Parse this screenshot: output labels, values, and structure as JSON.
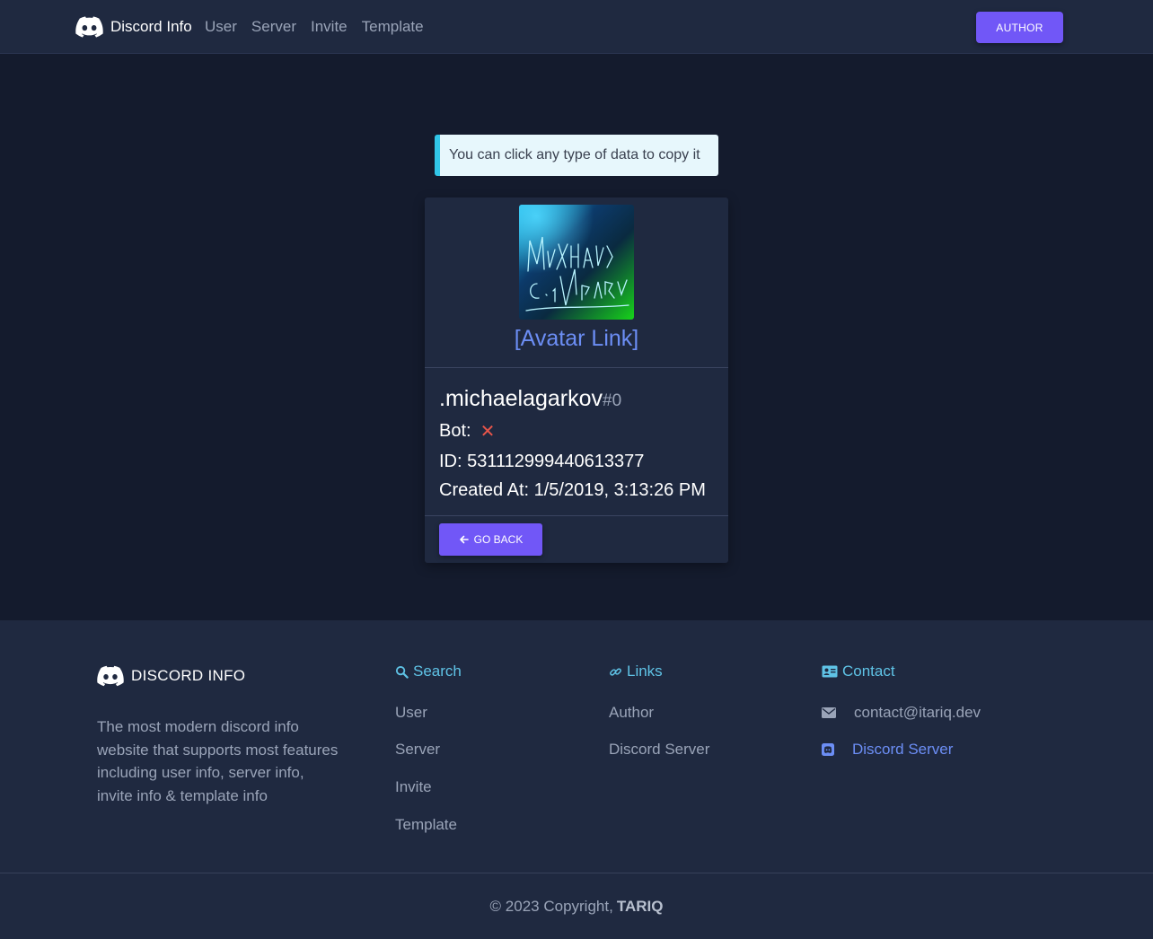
{
  "nav": {
    "brand": "Discord Info",
    "links": [
      "User",
      "Server",
      "Invite",
      "Template"
    ],
    "author_button": "AUTHOR"
  },
  "alert": {
    "text": "You can click any type of data to copy it"
  },
  "card": {
    "avatar_link": "[Avatar Link]",
    "username": ".michaelagarkov",
    "discriminator": "#0",
    "bot_label": "Bot:",
    "bot_value_icon": "cross-icon",
    "id_line": "ID: 531112999440613377",
    "created_line": "Created At: 1/5/2019, 3:13:26 PM",
    "back_button": "GO BACK"
  },
  "footer": {
    "brand": "DISCORD INFO",
    "description": "The most modern discord info website that supports most features including user info, server info, invite info & template info",
    "search": {
      "heading": "Search",
      "items": [
        "User",
        "Server",
        "Invite",
        "Template"
      ]
    },
    "links": {
      "heading": "Links",
      "items": [
        "Author",
        "Discord Server"
      ]
    },
    "contact": {
      "heading": "Contact",
      "email": "contact@itariq.dev",
      "discord": "Discord Server"
    }
  },
  "copyright": {
    "text": "© 2023 Copyright,",
    "name": "TARIQ"
  },
  "colors": {
    "accent": "#7157f7",
    "link": "#6c8ef5",
    "footer_heading": "#5fc3e6",
    "background": "#141b2d",
    "surface": "#1f2940"
  }
}
